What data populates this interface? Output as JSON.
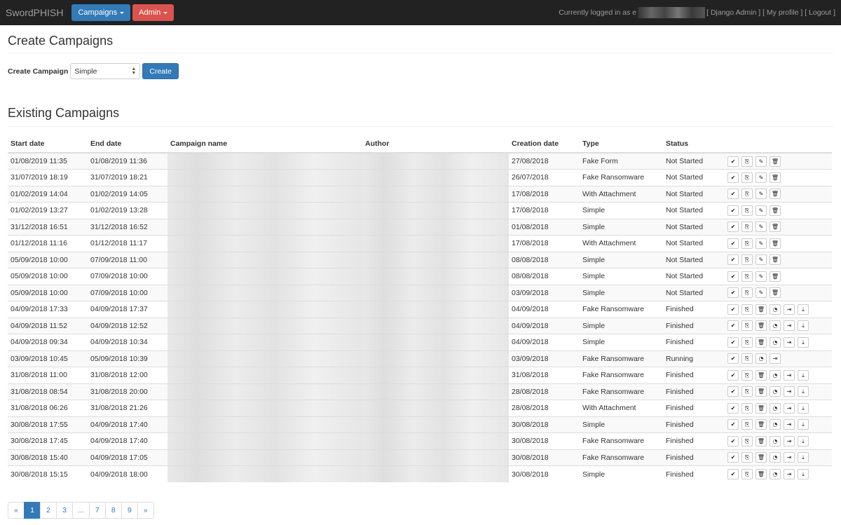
{
  "nav": {
    "brand": "SwordPHISH",
    "campaigns_label": "Campaigns",
    "admin_label": "Admin",
    "logged_in_prefix": "Currently logged in as",
    "logged_in_visible_char": "e",
    "django_admin": "[ Django Admin ]",
    "my_profile": "[ My profile ]",
    "logout": "[ Logout ]"
  },
  "create_section": {
    "title": "Create Campaigns",
    "label": "Create Campaign",
    "select_value": "Simple",
    "button": "Create"
  },
  "existing": {
    "title": "Existing Campaigns",
    "columns": [
      "Start date",
      "End date",
      "Campaign name",
      "Author",
      "Creation date",
      "Type",
      "Status"
    ],
    "rows": [
      {
        "start": "01/08/2019 11:35",
        "end": "01/08/2019 11:36",
        "created": "27/08/2018",
        "type": "Fake Form",
        "status": "Not Started",
        "actions": [
          "check-icon",
          "copy-icon",
          "edit-icon",
          "trash-icon"
        ]
      },
      {
        "start": "31/07/2019 18:19",
        "end": "31/07/2019 18:21",
        "created": "26/07/2018",
        "type": "Fake Ransomware",
        "status": "Not Started",
        "actions": [
          "check-icon",
          "copy-icon",
          "edit-icon",
          "trash-icon"
        ]
      },
      {
        "start": "01/02/2019 14:04",
        "end": "01/02/2019 14:05",
        "created": "17/08/2018",
        "type": "With Attachment",
        "status": "Not Started",
        "actions": [
          "check-icon",
          "copy-icon",
          "edit-icon",
          "trash-icon"
        ]
      },
      {
        "start": "01/02/2019 13:27",
        "end": "01/02/2019 13:28",
        "created": "17/08/2018",
        "type": "Simple",
        "status": "Not Started",
        "actions": [
          "check-icon",
          "copy-icon",
          "edit-icon",
          "trash-icon"
        ]
      },
      {
        "start": "31/12/2018 16:51",
        "end": "31/12/2018 16:52",
        "created": "01/08/2018",
        "type": "Simple",
        "status": "Not Started",
        "actions": [
          "check-icon",
          "copy-icon",
          "edit-icon",
          "trash-icon"
        ]
      },
      {
        "start": "01/12/2018 11:16",
        "end": "01/12/2018 11:17",
        "created": "17/08/2018",
        "type": "With Attachment",
        "status": "Not Started",
        "actions": [
          "check-icon",
          "copy-icon",
          "edit-icon",
          "trash-icon"
        ]
      },
      {
        "start": "05/09/2018 10:00",
        "end": "07/09/2018 11:00",
        "created": "08/08/2018",
        "type": "Simple",
        "status": "Not Started",
        "actions": [
          "check-icon",
          "copy-icon",
          "edit-icon",
          "trash-icon"
        ]
      },
      {
        "start": "05/09/2018 10:00",
        "end": "07/09/2018 10:00",
        "created": "08/08/2018",
        "type": "Simple",
        "status": "Not Started",
        "actions": [
          "check-icon",
          "copy-icon",
          "edit-icon",
          "trash-icon"
        ]
      },
      {
        "start": "05/09/2018 10:00",
        "end": "07/09/2018 10:00",
        "created": "03/09/2018",
        "type": "Simple",
        "status": "Not Started",
        "actions": [
          "check-icon",
          "copy-icon",
          "edit-icon",
          "trash-icon"
        ]
      },
      {
        "start": "04/09/2018 17:33",
        "end": "04/09/2018 17:37",
        "created": "04/09/2018",
        "type": "Fake Ransomware",
        "status": "Finished",
        "actions": [
          "check-icon",
          "copy-icon",
          "trash-icon",
          "stats-icon",
          "export-icon",
          "download-icon"
        ]
      },
      {
        "start": "04/09/2018 11:52",
        "end": "04/09/2018 12:52",
        "created": "04/09/2018",
        "type": "Simple",
        "status": "Finished",
        "actions": [
          "check-icon",
          "copy-icon",
          "trash-icon",
          "stats-icon",
          "export-icon",
          "download-icon"
        ]
      },
      {
        "start": "04/09/2018 09:34",
        "end": "04/09/2018 10:34",
        "created": "04/09/2018",
        "type": "Simple",
        "status": "Finished",
        "actions": [
          "check-icon",
          "copy-icon",
          "trash-icon",
          "stats-icon",
          "export-icon",
          "download-icon"
        ]
      },
      {
        "start": "03/09/2018 10:45",
        "end": "05/09/2018 10:39",
        "created": "03/09/2018",
        "type": "Fake Ransomware",
        "status": "Running",
        "actions": [
          "check-icon",
          "copy-icon",
          "stats-icon",
          "export-icon"
        ]
      },
      {
        "start": "31/08/2018 11:00",
        "end": "31/08/2018 12:00",
        "created": "31/08/2018",
        "type": "Fake Ransomware",
        "status": "Finished",
        "actions": [
          "check-icon",
          "copy-icon",
          "trash-icon",
          "stats-icon",
          "export-icon",
          "download-icon"
        ]
      },
      {
        "start": "31/08/2018 08:54",
        "end": "31/08/2018 20:00",
        "created": "28/08/2018",
        "type": "Fake Ransomware",
        "status": "Finished",
        "actions": [
          "check-icon",
          "copy-icon",
          "trash-icon",
          "stats-icon",
          "export-icon",
          "download-icon"
        ]
      },
      {
        "start": "31/08/2018 06:26",
        "end": "31/08/2018 21:26",
        "created": "28/08/2018",
        "type": "With Attachment",
        "status": "Finished",
        "actions": [
          "check-icon",
          "copy-icon",
          "trash-icon",
          "stats-icon",
          "export-icon",
          "download-icon"
        ]
      },
      {
        "start": "30/08/2018 17:55",
        "end": "04/09/2018 17:40",
        "created": "30/08/2018",
        "type": "Simple",
        "status": "Finished",
        "actions": [
          "check-icon",
          "copy-icon",
          "trash-icon",
          "stats-icon",
          "export-icon",
          "download-icon"
        ]
      },
      {
        "start": "30/08/2018 17:45",
        "end": "04/09/2018 17:40",
        "created": "30/08/2018",
        "type": "Fake Ransomware",
        "status": "Finished",
        "actions": [
          "check-icon",
          "copy-icon",
          "trash-icon",
          "stats-icon",
          "export-icon",
          "download-icon"
        ]
      },
      {
        "start": "30/08/2018 15:40",
        "end": "04/09/2018 17:05",
        "created": "30/08/2018",
        "type": "Fake Ransomware",
        "status": "Finished",
        "actions": [
          "check-icon",
          "copy-icon",
          "trash-icon",
          "stats-icon",
          "export-icon",
          "download-icon"
        ]
      },
      {
        "start": "30/08/2018 15:15",
        "end": "04/09/2018 18:00",
        "created": "30/08/2018",
        "type": "Simple",
        "status": "Finished",
        "actions": [
          "check-icon",
          "copy-icon",
          "trash-icon",
          "stats-icon",
          "export-icon",
          "download-icon"
        ]
      }
    ]
  },
  "pagination": [
    "«",
    "1",
    "2",
    "3",
    "...",
    "7",
    "8",
    "9",
    "»"
  ],
  "pagination_active": "1",
  "colors": {
    "navbar": "#222222",
    "primary": "#337ab7",
    "danger": "#d9534f"
  }
}
